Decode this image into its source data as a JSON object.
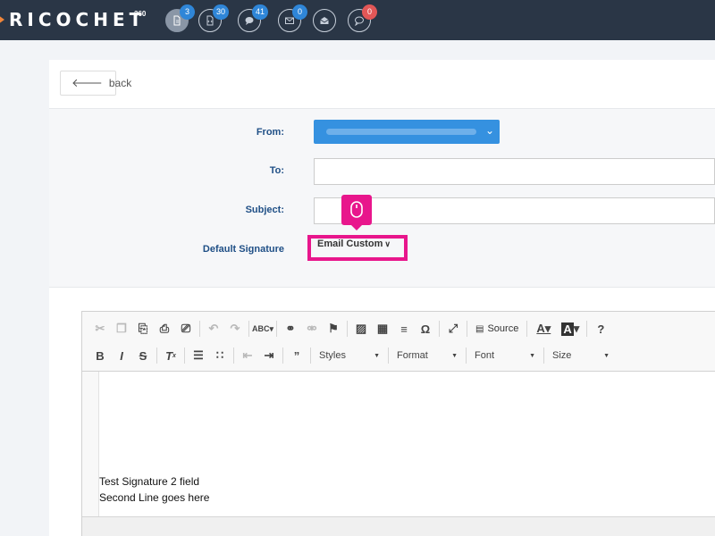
{
  "app": {
    "logo_text": "RICOCHET",
    "logo_suffix": "360"
  },
  "nav": [
    {
      "icon": "document-icon",
      "badge": "3",
      "badge_color": "#2f86d8"
    },
    {
      "icon": "document-code-icon",
      "badge": "30",
      "badge_color": "#2f86d8"
    },
    {
      "icon": "chat-icon",
      "badge": "41",
      "badge_color": "#2f86d8"
    },
    {
      "icon": "envelope-icon",
      "badge": "0",
      "badge_color": "#2f86d8"
    },
    {
      "icon": "envelope-open-icon",
      "badge": "",
      "badge_color": ""
    },
    {
      "icon": "comment-icon",
      "badge": "0",
      "badge_color": "#e25757"
    }
  ],
  "back_label": "back",
  "form": {
    "from_label": "From:",
    "to_label": "To:",
    "to_value": "",
    "subject_label": "Subject:",
    "subject_value": "",
    "signature_label": "Default Signature",
    "signature_value": "Email Custom"
  },
  "toolbar": {
    "source_label": "Source",
    "styles_label": "Styles",
    "format_label": "Format",
    "font_label": "Font",
    "size_label": "Size"
  },
  "editor": {
    "line1": "Test Signature 2 field",
    "line2": "Second Line goes here"
  },
  "colors": {
    "topbar": "#2a3646",
    "accent_blue": "#3591e0",
    "highlight": "#e8168c",
    "label_blue": "#1f4f86"
  }
}
